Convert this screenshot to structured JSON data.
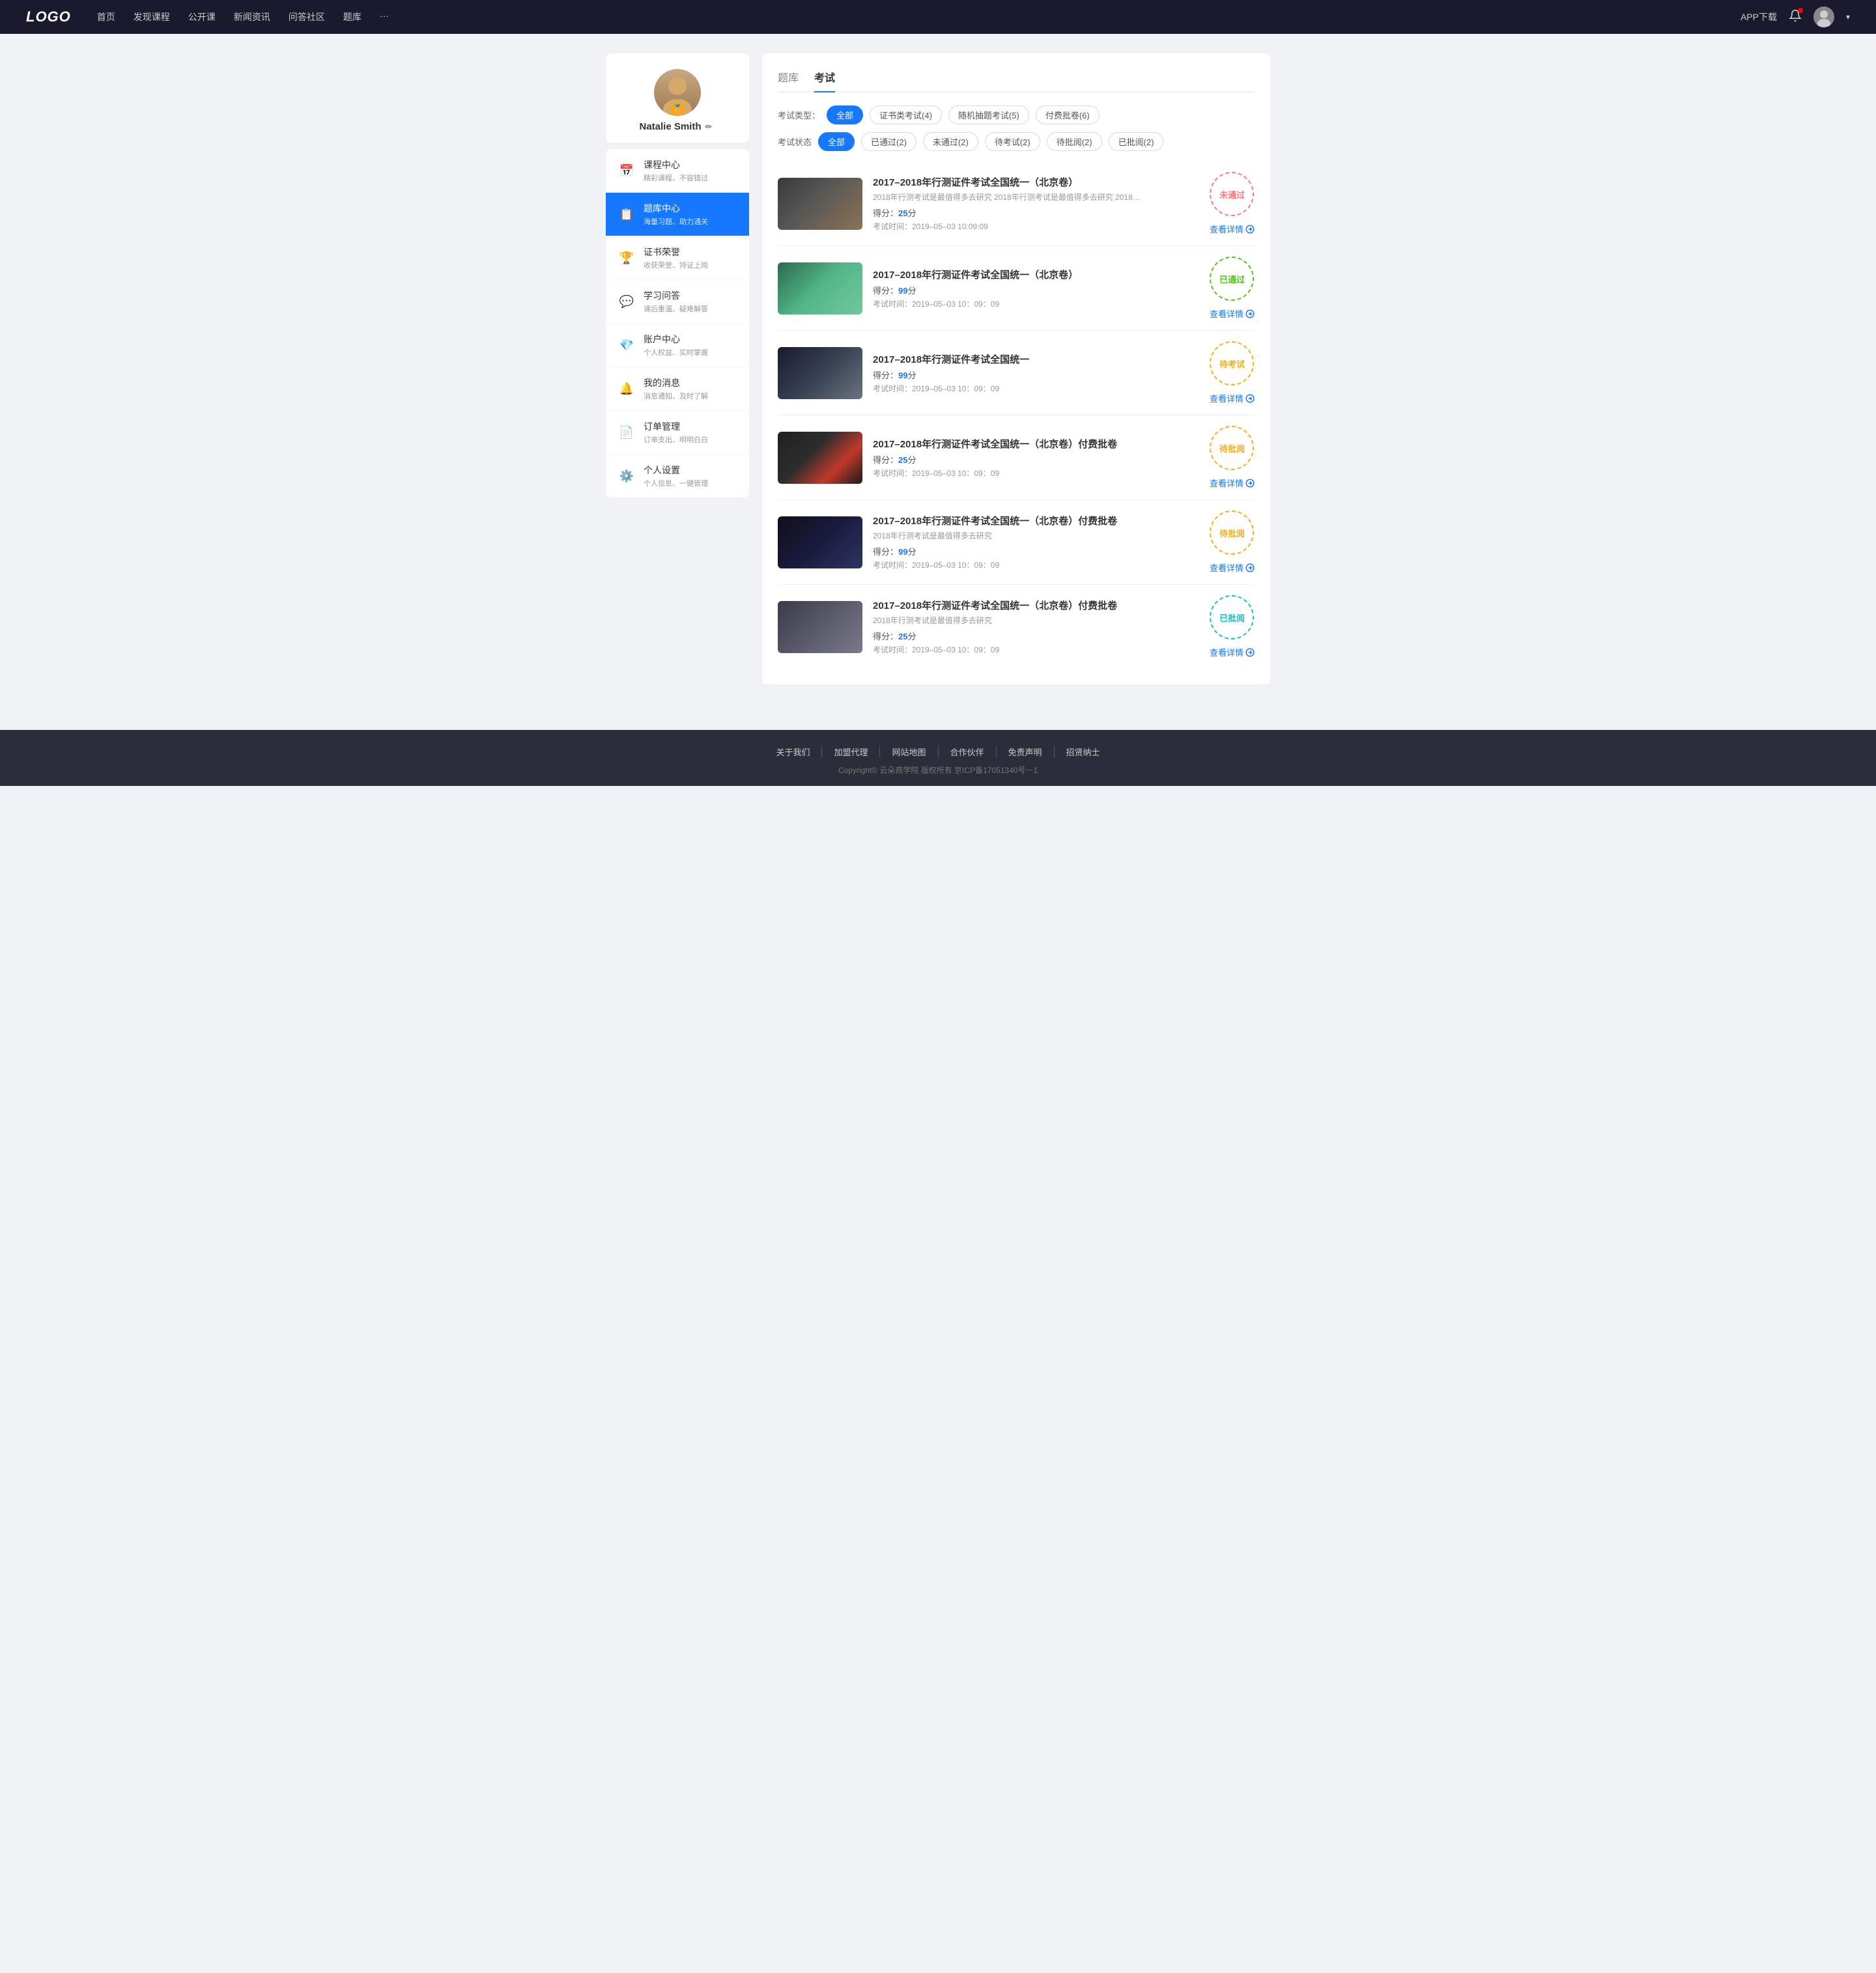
{
  "header": {
    "logo": "LOGO",
    "nav": [
      {
        "label": "首页"
      },
      {
        "label": "发现课程"
      },
      {
        "label": "公开课"
      },
      {
        "label": "新闻资讯"
      },
      {
        "label": "问答社区"
      },
      {
        "label": "题库"
      },
      {
        "label": "···"
      }
    ],
    "app_download": "APP下载",
    "chevron_label": "▾"
  },
  "sidebar": {
    "profile": {
      "name": "Natalie Smith",
      "badge": "🏅"
    },
    "nav_items": [
      {
        "id": "course",
        "icon": "📅",
        "title": "课程中心",
        "sub": "精彩课程、不容错过",
        "active": false
      },
      {
        "id": "question",
        "icon": "📋",
        "title": "题库中心",
        "sub": "海量习题、助力通关",
        "active": true
      },
      {
        "id": "cert",
        "icon": "🏆",
        "title": "证书荣誉",
        "sub": "收获荣誉、持证上岗",
        "active": false
      },
      {
        "id": "qa",
        "icon": "💬",
        "title": "学习问答",
        "sub": "课后重温、疑难解答",
        "active": false
      },
      {
        "id": "account",
        "icon": "💎",
        "title": "账户中心",
        "sub": "个人权益、实时掌握",
        "active": false
      },
      {
        "id": "message",
        "icon": "🔔",
        "title": "我的消息",
        "sub": "消息通知、及时了解",
        "active": false
      },
      {
        "id": "order",
        "icon": "📄",
        "title": "订单管理",
        "sub": "订单支出、明明白白",
        "active": false
      },
      {
        "id": "settings",
        "icon": "⚙️",
        "title": "个人设置",
        "sub": "个人信息、一键管理",
        "active": false
      }
    ]
  },
  "content": {
    "tabs": [
      {
        "label": "题库",
        "active": false
      },
      {
        "label": "考试",
        "active": true
      }
    ],
    "type_filter": {
      "label": "考试类型：",
      "options": [
        {
          "label": "全部",
          "active": true
        },
        {
          "label": "证书类考试(4)",
          "active": false
        },
        {
          "label": "随机抽题考试(5)",
          "active": false
        },
        {
          "label": "付费批卷(6)",
          "active": false
        }
      ]
    },
    "status_filter": {
      "label": "考试状态",
      "options": [
        {
          "label": "全部",
          "active": true
        },
        {
          "label": "已通过(2)",
          "active": false
        },
        {
          "label": "未通过(2)",
          "active": false
        },
        {
          "label": "待考试(2)",
          "active": false
        },
        {
          "label": "待批阅(2)",
          "active": false
        },
        {
          "label": "已批阅(2)",
          "active": false
        }
      ]
    },
    "exams": [
      {
        "id": 1,
        "title": "2017–2018年行测证件考试全国统一（北京卷）",
        "desc": "2018年行测考试是最值得多去研究 2018年行测考试是最值得多去研究 2018年行…",
        "score_label": "得分：",
        "score": "25",
        "score_unit": "分",
        "time_label": "考试时间：",
        "time": "2019–05–03  10:09:09",
        "status": "未通过",
        "status_type": "unpass",
        "thumb_class": "thumb-1",
        "detail_label": "查看详情"
      },
      {
        "id": 2,
        "title": "2017–2018年行测证件考试全国统一（北京卷）",
        "desc": "",
        "score_label": "得分：",
        "score": "99",
        "score_unit": "分",
        "time_label": "考试时间：",
        "time": "2019–05–03  10：09：09",
        "status": "已通过",
        "status_type": "pass",
        "thumb_class": "thumb-2",
        "detail_label": "查看详情"
      },
      {
        "id": 3,
        "title": "2017–2018年行测证件考试全国统一",
        "desc": "",
        "score_label": "得分：",
        "score": "99",
        "score_unit": "分",
        "time_label": "考试时间：",
        "time": "2019–05–03  10：09：09",
        "status": "待考试",
        "status_type": "pending",
        "thumb_class": "thumb-3",
        "detail_label": "查看详情"
      },
      {
        "id": 4,
        "title": "2017–2018年行测证件考试全国统一（北京卷）付费批卷",
        "desc": "",
        "score_label": "得分：",
        "score": "25",
        "score_unit": "分",
        "time_label": "考试时间：",
        "time": "2019–05–03  10：09：09",
        "status": "待批阅",
        "status_type": "review-pending",
        "thumb_class": "thumb-4",
        "detail_label": "查看详情"
      },
      {
        "id": 5,
        "title": "2017–2018年行测证件考试全国统一（北京卷）付费批卷",
        "desc": "2018年行测考试是最值得多去研究",
        "score_label": "得分：",
        "score": "99",
        "score_unit": "分",
        "time_label": "考试时间：",
        "time": "2019–05–03  10：09：09",
        "status": "待批阅",
        "status_type": "review-pending",
        "thumb_class": "thumb-5",
        "detail_label": "查看详情"
      },
      {
        "id": 6,
        "title": "2017–2018年行测证件考试全国统一（北京卷）付费批卷",
        "desc": "2018年行测考试是最值得多去研究",
        "score_label": "得分：",
        "score": "25",
        "score_unit": "分",
        "time_label": "考试时间：",
        "time": "2019–05–03  10：09：09",
        "status": "已批阅",
        "status_type": "reviewed",
        "thumb_class": "thumb-6",
        "detail_label": "查看详情"
      }
    ]
  },
  "footer": {
    "links": [
      {
        "label": "关于我们"
      },
      {
        "label": "加盟代理"
      },
      {
        "label": "网站地图"
      },
      {
        "label": "合作伙伴"
      },
      {
        "label": "免责声明"
      },
      {
        "label": "招贤纳士"
      }
    ],
    "copyright": "Copyright© 云朵商学院  版权所有    京ICP备17051340号－1"
  }
}
